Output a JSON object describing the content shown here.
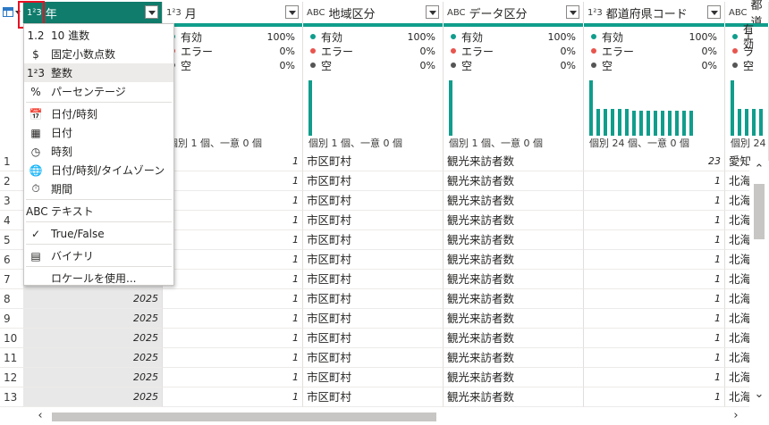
{
  "columns": [
    {
      "type_icon": "1²3",
      "name": "年",
      "selected": true
    },
    {
      "type_icon": "1²3",
      "name": "月"
    },
    {
      "type_icon": "ABC",
      "name": "地域区分"
    },
    {
      "type_icon": "ABC",
      "name": "データ区分"
    },
    {
      "type_icon": "1²3",
      "name": "都道府県コード"
    },
    {
      "type_icon": "ABC",
      "name": "都道"
    }
  ],
  "profiles": [
    null,
    {
      "valid_label": "有効",
      "valid_pct": "100%",
      "error_label": "エラー",
      "error_pct": "0%",
      "empty_label": "空",
      "empty_pct": "0%",
      "distinct": "個別 1 個、一意 0 個"
    },
    {
      "valid_label": "有効",
      "valid_pct": "100%",
      "error_label": "エラー",
      "error_pct": "0%",
      "empty_label": "空",
      "empty_pct": "0%",
      "distinct": "個別 1 個、一意 0 個"
    },
    {
      "valid_label": "有効",
      "valid_pct": "100%",
      "error_label": "エラー",
      "error_pct": "0%",
      "empty_label": "空",
      "empty_pct": "0%",
      "distinct": "個別 1 個、一意 0 個"
    },
    {
      "valid_label": "有効",
      "valid_pct": "100%",
      "error_label": "エラー",
      "error_pct": "0%",
      "empty_label": "空",
      "empty_pct": "0%",
      "distinct": "個別 24 個、一意 0 個"
    },
    {
      "valid_label": "有効",
      "error_label": "エラー",
      "empty_label": "空",
      "distinct": "個別 24"
    }
  ],
  "menu": {
    "items": [
      {
        "icon": "1.2",
        "label": "10 進数"
      },
      {
        "icon": "$",
        "label": "固定小数点数"
      },
      {
        "icon": "1²3",
        "label": "整数",
        "active": true
      },
      {
        "icon": "%",
        "label": "パーセンテージ"
      },
      {
        "icon": "📅",
        "label": "日付/時刻",
        "sep_before": true
      },
      {
        "icon": "▦",
        "label": "日付"
      },
      {
        "icon": "◷",
        "label": "時刻"
      },
      {
        "icon": "🌐",
        "label": "日付/時刻/タイムゾーン"
      },
      {
        "icon": "⏱",
        "label": "期間"
      },
      {
        "icon": "ABC",
        "label": "テキスト",
        "sep_before": true
      },
      {
        "icon": "✓",
        "label": "True/False",
        "sep_before": true
      },
      {
        "icon": "▤",
        "label": "バイナリ",
        "sep_before": true
      },
      {
        "icon": "",
        "label": "ロケールを使用...",
        "sep_before": true
      }
    ]
  },
  "rows": [
    {
      "n": "1",
      "year": "",
      "month": "1",
      "region": "市区町村",
      "datatype": "観光来訪者数",
      "code": "23",
      "pref": "愛知"
    },
    {
      "n": "2",
      "year": "",
      "month": "1",
      "region": "市区町村",
      "datatype": "観光来訪者数",
      "code": "1",
      "pref": "北海"
    },
    {
      "n": "3",
      "year": "",
      "month": "1",
      "region": "市区町村",
      "datatype": "観光来訪者数",
      "code": "1",
      "pref": "北海"
    },
    {
      "n": "4",
      "year": "",
      "month": "1",
      "region": "市区町村",
      "datatype": "観光来訪者数",
      "code": "1",
      "pref": "北海"
    },
    {
      "n": "5",
      "year": "",
      "month": "1",
      "region": "市区町村",
      "datatype": "観光来訪者数",
      "code": "1",
      "pref": "北海"
    },
    {
      "n": "6",
      "year": "",
      "month": "1",
      "region": "市区町村",
      "datatype": "観光来訪者数",
      "code": "1",
      "pref": "北海"
    },
    {
      "n": "7",
      "year": "",
      "month": "1",
      "region": "市区町村",
      "datatype": "観光来訪者数",
      "code": "1",
      "pref": "北海"
    },
    {
      "n": "8",
      "year": "2025",
      "month": "1",
      "region": "市区町村",
      "datatype": "観光来訪者数",
      "code": "1",
      "pref": "北海"
    },
    {
      "n": "9",
      "year": "2025",
      "month": "1",
      "region": "市区町村",
      "datatype": "観光来訪者数",
      "code": "1",
      "pref": "北海"
    },
    {
      "n": "10",
      "year": "2025",
      "month": "1",
      "region": "市区町村",
      "datatype": "観光来訪者数",
      "code": "1",
      "pref": "北海"
    },
    {
      "n": "11",
      "year": "2025",
      "month": "1",
      "region": "市区町村",
      "datatype": "観光来訪者数",
      "code": "1",
      "pref": "北海"
    },
    {
      "n": "12",
      "year": "2025",
      "month": "1",
      "region": "市区町村",
      "datatype": "観光来訪者数",
      "code": "1",
      "pref": "北海"
    },
    {
      "n": "13",
      "year": "2025",
      "month": "1",
      "region": "市区町村",
      "datatype": "観光来訪者数",
      "code": "1",
      "pref": "北海"
    }
  ],
  "colors": {
    "accent": "#109d8c",
    "selected_header": "#107c6c",
    "error_dot": "#e8554e",
    "empty_dot": "#555555",
    "highlight": "#e81123"
  }
}
